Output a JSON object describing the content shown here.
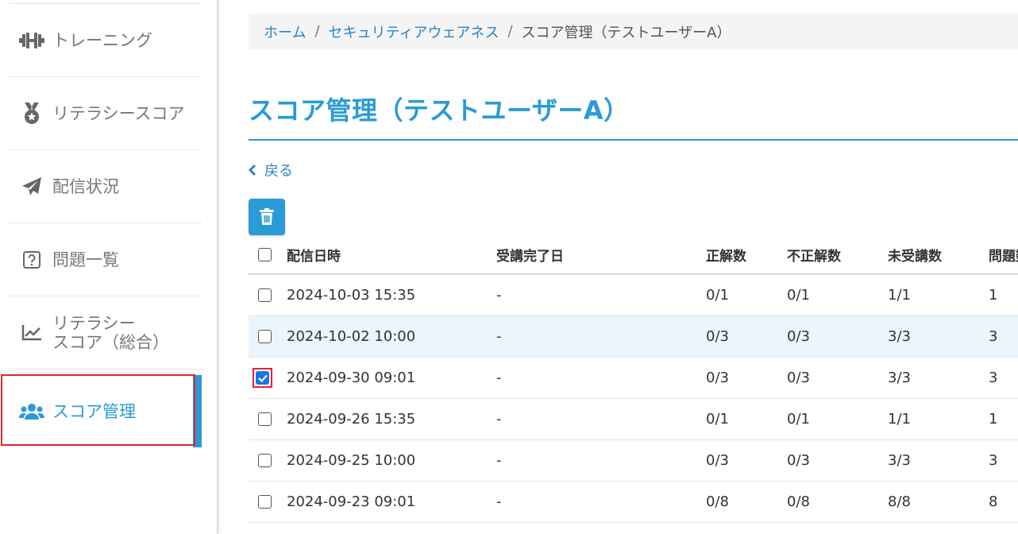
{
  "sidebar": {
    "items": [
      {
        "label": "トレーニング",
        "icon": "dumbbell-icon"
      },
      {
        "label": "リテラシースコア",
        "icon": "medal-icon"
      },
      {
        "label": "配信状況",
        "icon": "paper-plane-icon"
      },
      {
        "label": "問題一覧",
        "icon": "question-square-icon"
      },
      {
        "label": "リテラシー\nスコア（総合）",
        "label_line1": "リテラシー",
        "label_line2": "スコア（総合）",
        "icon": "chart-line-icon"
      },
      {
        "label": "スコア管理",
        "icon": "users-icon",
        "active": true
      }
    ]
  },
  "breadcrumb": {
    "home": "ホーム",
    "section": "セキュリティアウェアネス",
    "current": "スコア管理（テストユーザーA）",
    "separator": "/"
  },
  "page": {
    "title": "スコア管理（テストユーザーA）",
    "back_label": "戻る"
  },
  "table": {
    "headers": {
      "date": "配信日時",
      "completed": "受講完了日",
      "correct": "正解数",
      "wrong": "不正解数",
      "untaken": "未受講数",
      "qcount": "問題数"
    },
    "rows": [
      {
        "date": "2024-10-03 15:35",
        "completed": "-",
        "correct": "0/1",
        "wrong": "0/1",
        "untaken": "1/1",
        "qcount": "1",
        "checked": false
      },
      {
        "date": "2024-10-02 10:00",
        "completed": "-",
        "correct": "0/3",
        "wrong": "0/3",
        "untaken": "3/3",
        "qcount": "3",
        "checked": false
      },
      {
        "date": "2024-09-30 09:01",
        "completed": "-",
        "correct": "0/3",
        "wrong": "0/3",
        "untaken": "3/3",
        "qcount": "3",
        "checked": true
      },
      {
        "date": "2024-09-26 15:35",
        "completed": "-",
        "correct": "0/1",
        "wrong": "0/1",
        "untaken": "1/1",
        "qcount": "1",
        "checked": false
      },
      {
        "date": "2024-09-25 10:00",
        "completed": "-",
        "correct": "0/3",
        "wrong": "0/3",
        "untaken": "3/3",
        "qcount": "3",
        "checked": false
      },
      {
        "date": "2024-09-23 09:01",
        "completed": "-",
        "correct": "0/8",
        "wrong": "0/8",
        "untaken": "8/8",
        "qcount": "8",
        "checked": false
      }
    ]
  },
  "colors": {
    "accent": "#2a9bd6",
    "link": "#2a84c4",
    "highlight": "#e0262b",
    "row_alt": "#eaf5fc"
  }
}
